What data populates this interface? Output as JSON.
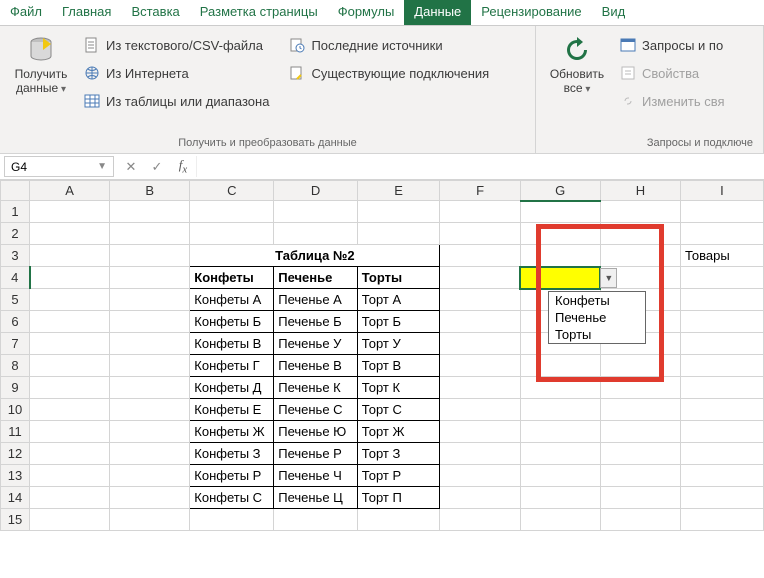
{
  "tabs": [
    "Файл",
    "Главная",
    "Вставка",
    "Разметка страницы",
    "Формулы",
    "Данные",
    "Рецензирование",
    "Вид"
  ],
  "active_tab": "Данные",
  "ribbon": {
    "group1": {
      "big": "Получить\nданные",
      "items": [
        "Из текстового/CSV-файла",
        "Из Интернета",
        "Из таблицы или диапазона"
      ],
      "label": "Получить и преобразовать данные"
    },
    "group1b": {
      "items": [
        "Последние источники",
        "Существующие подключения"
      ]
    },
    "group2": {
      "big": "Обновить\nвсе",
      "items": [
        "Запросы и по",
        "Свойства",
        "Изменить свя"
      ],
      "label": "Запросы и подключе"
    }
  },
  "name_box": "G4",
  "formula": "",
  "columns": [
    "A",
    "B",
    "C",
    "D",
    "E",
    "F",
    "G",
    "H",
    "I"
  ],
  "row_count": 15,
  "table2": {
    "title": "Таблица №2",
    "headers": [
      "Конфеты",
      "Печенье",
      "Торты"
    ],
    "rows": [
      [
        "Конфеты А",
        "Печенье А",
        "Торт А"
      ],
      [
        "Конфеты Б",
        "Печенье Б",
        "Торт Б"
      ],
      [
        "Конфеты В",
        "Печенье У",
        "Торт У"
      ],
      [
        "Конфеты Г",
        "Печенье В",
        "Торт В"
      ],
      [
        "Конфеты Д",
        "Печенье К",
        "Торт К"
      ],
      [
        "Конфеты Е",
        "Печенье С",
        "Торт С"
      ],
      [
        "Конфеты Ж",
        "Печенье Ю",
        "Торт Ж"
      ],
      [
        "Конфеты З",
        "Печенье Р",
        "Торт З"
      ],
      [
        "Конфеты Р",
        "Печенье Ч",
        "Торт Р"
      ],
      [
        "Конфеты С",
        "Печенье Ц",
        "Торт П"
      ]
    ]
  },
  "g3_label": "Товары",
  "dropdown": {
    "options": [
      "Конфеты",
      "Печенье",
      "Торты"
    ]
  },
  "active_cell": {
    "row": 4,
    "col": "G"
  }
}
